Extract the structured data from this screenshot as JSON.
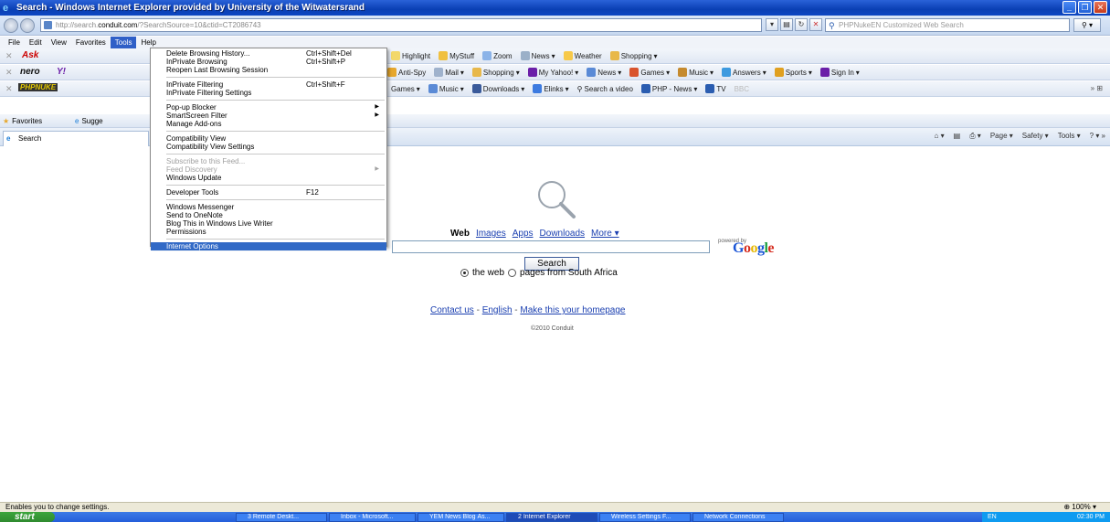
{
  "window": {
    "title": "Search - Windows Internet Explorer provided by University of the Witwatersrand",
    "minimize": "_",
    "maximize": "❐",
    "close": "✕"
  },
  "address": {
    "url_prefix": "http://search.",
    "url_domain": "conduit.com",
    "url_suffix": "/?SearchSource=10&ctid=CT2086743",
    "search_placeholder": "PHPNukeEN Customized Web Search"
  },
  "menubar": [
    "File",
    "Edit",
    "View",
    "Favorites",
    "Tools",
    "Help"
  ],
  "toolbars": {
    "row1": [
      "Highlight",
      "MyStuff",
      "Zoom",
      "News",
      "Weather",
      "Shopping"
    ],
    "row2": [
      "Anti-Spy",
      "Mail",
      "Shopping",
      "My Yahoo!",
      "News",
      "Games",
      "Music",
      "Answers",
      "Sports",
      "Sign In"
    ],
    "row3": [
      "Games",
      "Music",
      "Downloads",
      "Elinks",
      "Search a video",
      "PHP - News",
      "TV",
      "BBC"
    ],
    "nero": "nero",
    "yahoo": "Y!",
    "ask": "Ask",
    "phpnuke": "PHPNUKE"
  },
  "favbar": {
    "favorites": "Favorites",
    "suggested": "Sugge"
  },
  "tab": {
    "label": "Search"
  },
  "commandbar": [
    "Page",
    "Safety",
    "Tools"
  ],
  "tools_menu": {
    "groups": [
      [
        {
          "label": "Delete Browsing History...",
          "shortcut": "Ctrl+Shift+Del"
        },
        {
          "label": "InPrivate Browsing",
          "shortcut": "Ctrl+Shift+P"
        },
        {
          "label": "Reopen Last Browsing Session",
          "shortcut": ""
        }
      ],
      [
        {
          "label": "InPrivate Filtering",
          "shortcut": "Ctrl+Shift+F"
        },
        {
          "label": "InPrivate Filtering Settings",
          "shortcut": ""
        }
      ],
      [
        {
          "label": "Pop-up Blocker",
          "shortcut": "",
          "submenu": true
        },
        {
          "label": "SmartScreen Filter",
          "shortcut": "",
          "submenu": true
        },
        {
          "label": "Manage Add-ons",
          "shortcut": ""
        }
      ],
      [
        {
          "label": "Compatibility View",
          "shortcut": ""
        },
        {
          "label": "Compatibility View Settings",
          "shortcut": ""
        }
      ],
      [
        {
          "label": "Subscribe to this Feed...",
          "shortcut": "",
          "disabled": true
        },
        {
          "label": "Feed Discovery",
          "shortcut": "",
          "disabled": true,
          "submenu": true
        },
        {
          "label": "Windows Update",
          "shortcut": ""
        }
      ],
      [
        {
          "label": "Developer Tools",
          "shortcut": "F12"
        }
      ],
      [
        {
          "label": "Windows Messenger",
          "shortcut": ""
        },
        {
          "label": "Send to OneNote",
          "shortcut": ""
        },
        {
          "label": "Blog This in Windows Live Writer",
          "shortcut": ""
        },
        {
          "label": "Permissions",
          "shortcut": ""
        }
      ],
      [
        {
          "label": "Internet Options",
          "shortcut": "",
          "highlight": true
        }
      ]
    ]
  },
  "page": {
    "nav_current": "Web",
    "nav_links": [
      "Images",
      "Apps",
      "Downloads",
      "More ▾"
    ],
    "powered_by": "powered by",
    "google": "Google",
    "search_button": "Search",
    "radio_web": "the web",
    "radio_local": "pages from South Africa",
    "footer_contact": "Contact us",
    "footer_sep": " - ",
    "footer_english": "English",
    "footer_homepage": "Make this your homepage",
    "copyright": "©2010 Conduit"
  },
  "status": {
    "text": "Enables you to change settings.",
    "zoom": "100%"
  },
  "taskbar": {
    "start": "start",
    "tasks": [
      "3 Remote Deskt...",
      "Inbox - Microsoft...",
      "YEM News Blog Ås...",
      "2 Internet Explorer",
      "Wireless Settings F...",
      "Network Connections"
    ],
    "lang": "EN",
    "time": "02:30 PM"
  }
}
